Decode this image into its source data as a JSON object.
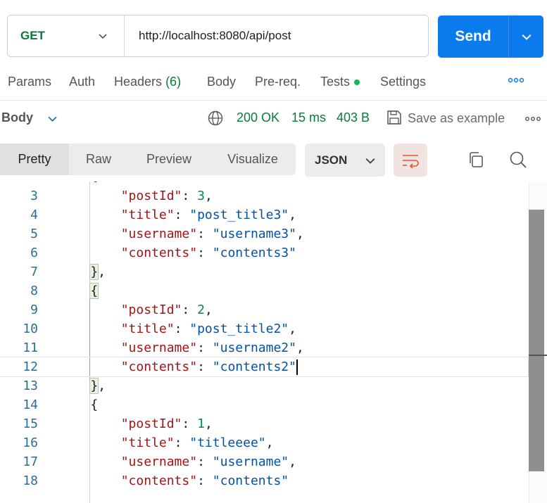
{
  "request": {
    "method": "GET",
    "url": "http://localhost:8080/api/post",
    "send_label": "Send"
  },
  "request_tabs": [
    {
      "label": "Params"
    },
    {
      "label": "Auth"
    },
    {
      "label": "Headers",
      "count": "(6)"
    },
    {
      "label": "Body"
    },
    {
      "label": "Pre-req."
    },
    {
      "label": "Tests"
    },
    {
      "label": "Settings"
    }
  ],
  "response": {
    "section_label": "Body",
    "status": "200 OK",
    "time": "15 ms",
    "size": "403 B",
    "save_label": "Save as example"
  },
  "view_modes": [
    "Pretty",
    "Raw",
    "Preview",
    "Visualize"
  ],
  "active_view": "Pretty",
  "format": "JSON",
  "colors": {
    "send_button": "#097bed",
    "method": "#0a7a3a",
    "status": "#0a7a3a",
    "tests_dot": "#0cbb52",
    "json_key": "#a31515",
    "json_string": "#0451a5",
    "json_number": "#098658"
  },
  "icons": [
    "chevron-down-icon",
    "more-horizontal-icon",
    "globe-icon",
    "save-icon",
    "wrap-lines-icon",
    "copy-icon",
    "search-icon"
  ],
  "code": {
    "partial_top_line": "{",
    "lines": [
      {
        "n": "3",
        "indent": "        ",
        "key": "\"postId\"",
        "sep": ": ",
        "value": "3",
        "vtype": "num",
        "trail": ","
      },
      {
        "n": "4",
        "indent": "        ",
        "key": "\"title\"",
        "sep": ": ",
        "value": "\"post_title3\"",
        "vtype": "str",
        "trail": ","
      },
      {
        "n": "5",
        "indent": "        ",
        "key": "\"username\"",
        "sep": ": ",
        "value": "\"username3\"",
        "vtype": "str",
        "trail": ","
      },
      {
        "n": "6",
        "indent": "        ",
        "key": "\"contents\"",
        "sep": ": ",
        "value": "\"contents3\"",
        "vtype": "str",
        "trail": ""
      },
      {
        "n": "7",
        "indent": "    ",
        "punct": "}",
        "trail": ",",
        "brace_hl": true
      },
      {
        "n": "8",
        "indent": "    ",
        "punct": "{",
        "trail": "",
        "brace_hl": true
      },
      {
        "n": "9",
        "indent": "        ",
        "key": "\"postId\"",
        "sep": ": ",
        "value": "2",
        "vtype": "num",
        "trail": ","
      },
      {
        "n": "10",
        "indent": "        ",
        "key": "\"title\"",
        "sep": ": ",
        "value": "\"post_title2\"",
        "vtype": "str",
        "trail": ","
      },
      {
        "n": "11",
        "indent": "        ",
        "key": "\"username\"",
        "sep": ": ",
        "value": "\"username2\"",
        "vtype": "str",
        "trail": ","
      },
      {
        "n": "12",
        "indent": "        ",
        "key": "\"contents\"",
        "sep": ": ",
        "value": "\"contents2\"",
        "vtype": "str",
        "trail": "",
        "active": true
      },
      {
        "n": "13",
        "indent": "    ",
        "punct": "}",
        "trail": ",",
        "brace_hl": true
      },
      {
        "n": "14",
        "indent": "    ",
        "punct": "{",
        "trail": ""
      },
      {
        "n": "15",
        "indent": "        ",
        "key": "\"postId\"",
        "sep": ": ",
        "value": "1",
        "vtype": "num",
        "trail": ","
      },
      {
        "n": "16",
        "indent": "        ",
        "key": "\"title\"",
        "sep": ": ",
        "value": "\"titleeee\"",
        "vtype": "str",
        "trail": ","
      },
      {
        "n": "17",
        "indent": "        ",
        "key": "\"username\"",
        "sep": ": ",
        "value": "\"username\"",
        "vtype": "str",
        "trail": ","
      },
      {
        "n": "18",
        "indent": "        ",
        "key": "\"contents\"",
        "sep": ": ",
        "value": "\"contents\"",
        "vtype": "str",
        "trail": ""
      }
    ]
  }
}
